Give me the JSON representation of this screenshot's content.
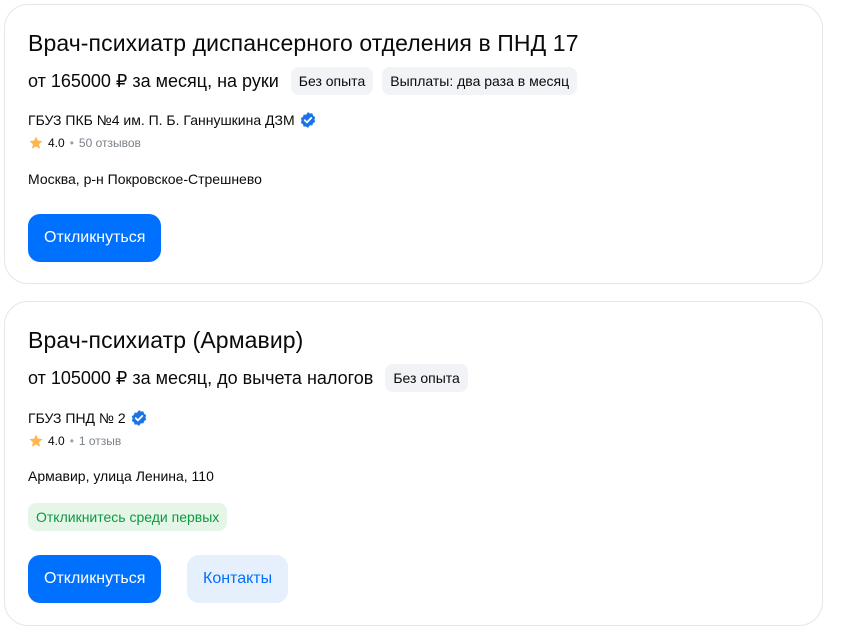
{
  "vacancies": [
    {
      "title": "Врач-психиатр диспансерного отделения в ПНД 17",
      "salary": "от 165000 ₽ за месяц, на руки",
      "tags": [
        "Без опыта",
        "Выплаты: два раза в месяц"
      ],
      "company": "ГБУЗ ПКБ №4 им. П. Б. Ганнушкина ДЗМ",
      "rating": "4.0",
      "separator": "•",
      "reviews": "50 отзывов",
      "address": "Москва, р-н Покровское-Стрешнево",
      "respond_label": "Откликнуться"
    },
    {
      "title": "Врач-психиатр (Армавир)",
      "salary": "от 105000 ₽ за месяц, до вычета налогов",
      "tags": [
        "Без опыта"
      ],
      "company": "ГБУЗ ПНД № 2",
      "rating": "4.0",
      "separator": "•",
      "reviews": "1 отзыв",
      "address": "Армавир, улица Ленина, 110",
      "badge": "Откликнитесь среди первых",
      "respond_label": "Откликнуться",
      "contacts_label": "Контакты"
    }
  ],
  "colors": {
    "primary": "#0070ff",
    "verified": "#1a73e8",
    "star": "#ffb74d",
    "badge_text": "#0b9a3e",
    "badge_bg": "#e5f6e8"
  },
  "icons": {
    "verified": "verified-check-icon",
    "rating": "star-icon"
  }
}
